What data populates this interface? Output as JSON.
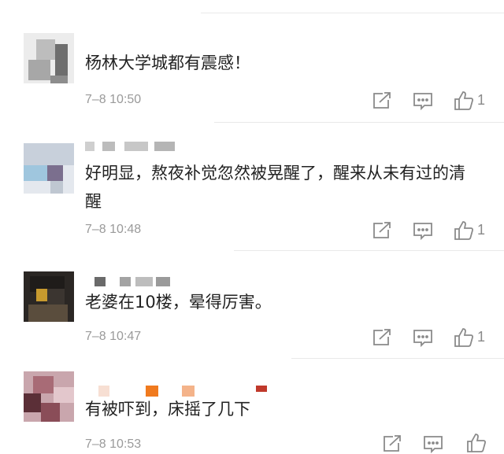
{
  "comments": [
    {
      "text": "杨林大学城都有震感！",
      "time": "7–8 10:50",
      "likes": "1",
      "avatar_palette": [
        "#d7d7d7",
        "#6e6e6e",
        "#bdbdbd",
        "#9c9c9c",
        "#e6e6e6"
      ]
    },
    {
      "text": "好明显，熬夜补觉忽然被晃醒了，醒来从未有过的清醒",
      "time": "7–8 10:48",
      "likes": "1",
      "avatar_palette": [
        "#c8d0db",
        "#9fc6de",
        "#7b6f8e",
        "#bfc7d1",
        "#e4e8ee"
      ]
    },
    {
      "text": "老婆在10楼，晕得厉害。",
      "time": "7–8 10:47",
      "likes": "1",
      "avatar_palette": [
        "#1f1c1a",
        "#3b3530",
        "#c79a2e",
        "#5a4d3d",
        "#2b2724"
      ]
    },
    {
      "text": "有被吓到，床摇了几下",
      "time": "7–8 10:53",
      "likes": "",
      "avatar_palette": [
        "#8a4d58",
        "#c9a6ad",
        "#5b2f37",
        "#e3c7cc",
        "#a86b76"
      ]
    }
  ],
  "icons": {
    "share": "share-icon",
    "comment": "comment-icon",
    "like": "thumbs-up-icon"
  },
  "colors": {
    "text": "#222222",
    "meta": "#9a9a9a",
    "icon": "#8a8a8a",
    "divider": "#e9e9e9"
  }
}
